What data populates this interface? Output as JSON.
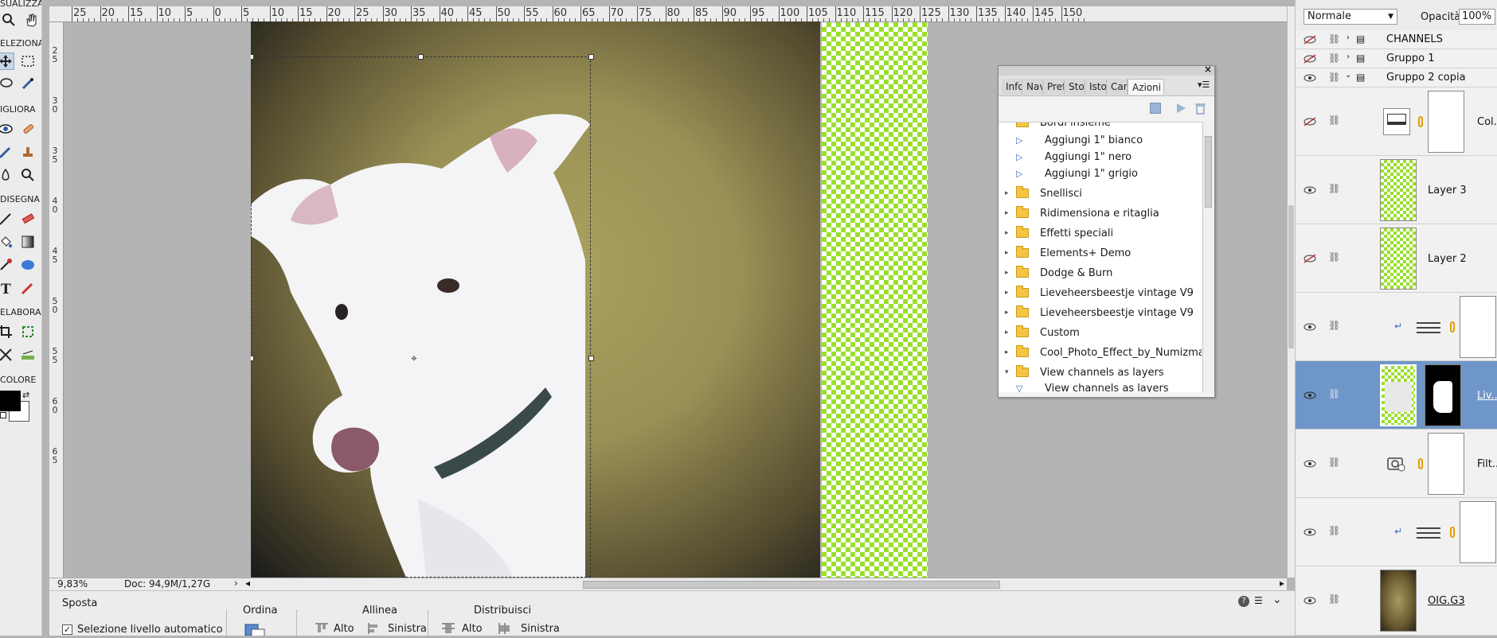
{
  "toolbox": {
    "sections": [
      "SUALIZZA",
      "ELEZIONA",
      "IGLIORA",
      "DISEGNA",
      "ELABORA",
      "COLORE"
    ]
  },
  "rulers": {
    "top_labels": [
      "25",
      "20",
      "15",
      "10",
      "5",
      "0",
      "5",
      "10",
      "15",
      "20",
      "25",
      "30",
      "35",
      "40",
      "45",
      "50",
      "55",
      "60",
      "65",
      "70",
      "75",
      "80",
      "85",
      "90",
      "95",
      "100",
      "105",
      "110",
      "115",
      "120",
      "125",
      "130",
      "135",
      "140",
      "145",
      "150"
    ],
    "left_labels": [
      "2\n5",
      "3\n0",
      "3\n5",
      "4\n0",
      "4\n5",
      "5\n0",
      "5\n5",
      "6\n0",
      "6\n5"
    ]
  },
  "status": {
    "zoom": "9,83%",
    "doc": "Doc: 94,9M/1,27G"
  },
  "options": {
    "tool_name": "Sposta",
    "auto_select_label": "Selezione livello automatico",
    "group_order": "Ordina",
    "group_align": "Allinea",
    "group_distribute": "Distribuisci",
    "align_top": "Alto",
    "align_left": "Sinistra",
    "dist_top": "Alto",
    "dist_left": "Sinistra"
  },
  "actions_panel": {
    "tabs": [
      "Info",
      "Nav",
      "Pref",
      "Stor",
      "Isto",
      "Can",
      "Azioni"
    ],
    "active_tab": "Azioni",
    "truncated_top": "Bordi insieme",
    "items": [
      {
        "type": "action",
        "label": "Aggiungi 1\" bianco"
      },
      {
        "type": "action",
        "label": "Aggiungi 1\" nero"
      },
      {
        "type": "action",
        "label": "Aggiungi 1\" grigio"
      },
      {
        "type": "folder",
        "label": "Snellisci",
        "expanded": false
      },
      {
        "type": "folder",
        "label": "Ridimensiona e ritaglia",
        "expanded": false
      },
      {
        "type": "folder",
        "label": "Effetti speciali",
        "expanded": false
      },
      {
        "type": "folder",
        "label": "Elements+ Demo",
        "expanded": false
      },
      {
        "type": "folder",
        "label": "Dodge & Burn",
        "expanded": false
      },
      {
        "type": "folder",
        "label": "Lieveheersbeestje vintage V9",
        "expanded": false
      },
      {
        "type": "folder",
        "label": "Lieveheersbeestje vintage V9",
        "expanded": false
      },
      {
        "type": "folder",
        "label": "Custom",
        "expanded": false
      },
      {
        "type": "folder",
        "label": "Cool_Photo_Effect_by_Numizmat",
        "expanded": false
      },
      {
        "type": "folder",
        "label": "View channels as layers",
        "expanded": true
      },
      {
        "type": "action-open",
        "label": "View channels as layers"
      }
    ]
  },
  "layers": {
    "blend_mode": "Normale",
    "opacity_label": "Opacità:",
    "opacity_value": "100%",
    "groups": [
      {
        "name": "CHANNELS",
        "visible": false
      },
      {
        "name": "Gruppo 1",
        "visible": false
      },
      {
        "name": "Gruppo 2 copia",
        "visible": true
      }
    ],
    "rows": [
      {
        "name": "Col...",
        "visible": false,
        "kind": "fill",
        "selected": false
      },
      {
        "name": "Layer 3",
        "visible": true,
        "kind": "transparent",
        "selected": false
      },
      {
        "name": "Layer 2",
        "visible": false,
        "kind": "transparent",
        "selected": false
      },
      {
        "name": "",
        "visible": true,
        "kind": "adjust",
        "selected": false
      },
      {
        "name": "Liv...",
        "visible": true,
        "kind": "masked",
        "selected": true
      },
      {
        "name": "Filt...",
        "visible": true,
        "kind": "filter",
        "selected": false
      },
      {
        "name": "",
        "visible": true,
        "kind": "adjust",
        "selected": false
      },
      {
        "name": "OIG.G3",
        "visible": true,
        "kind": "image",
        "selected": false
      }
    ]
  },
  "colors": {
    "selection_blue": "#6f96c9",
    "checker_green": "#9adf2c",
    "folder_yellow": "#f5c542"
  }
}
